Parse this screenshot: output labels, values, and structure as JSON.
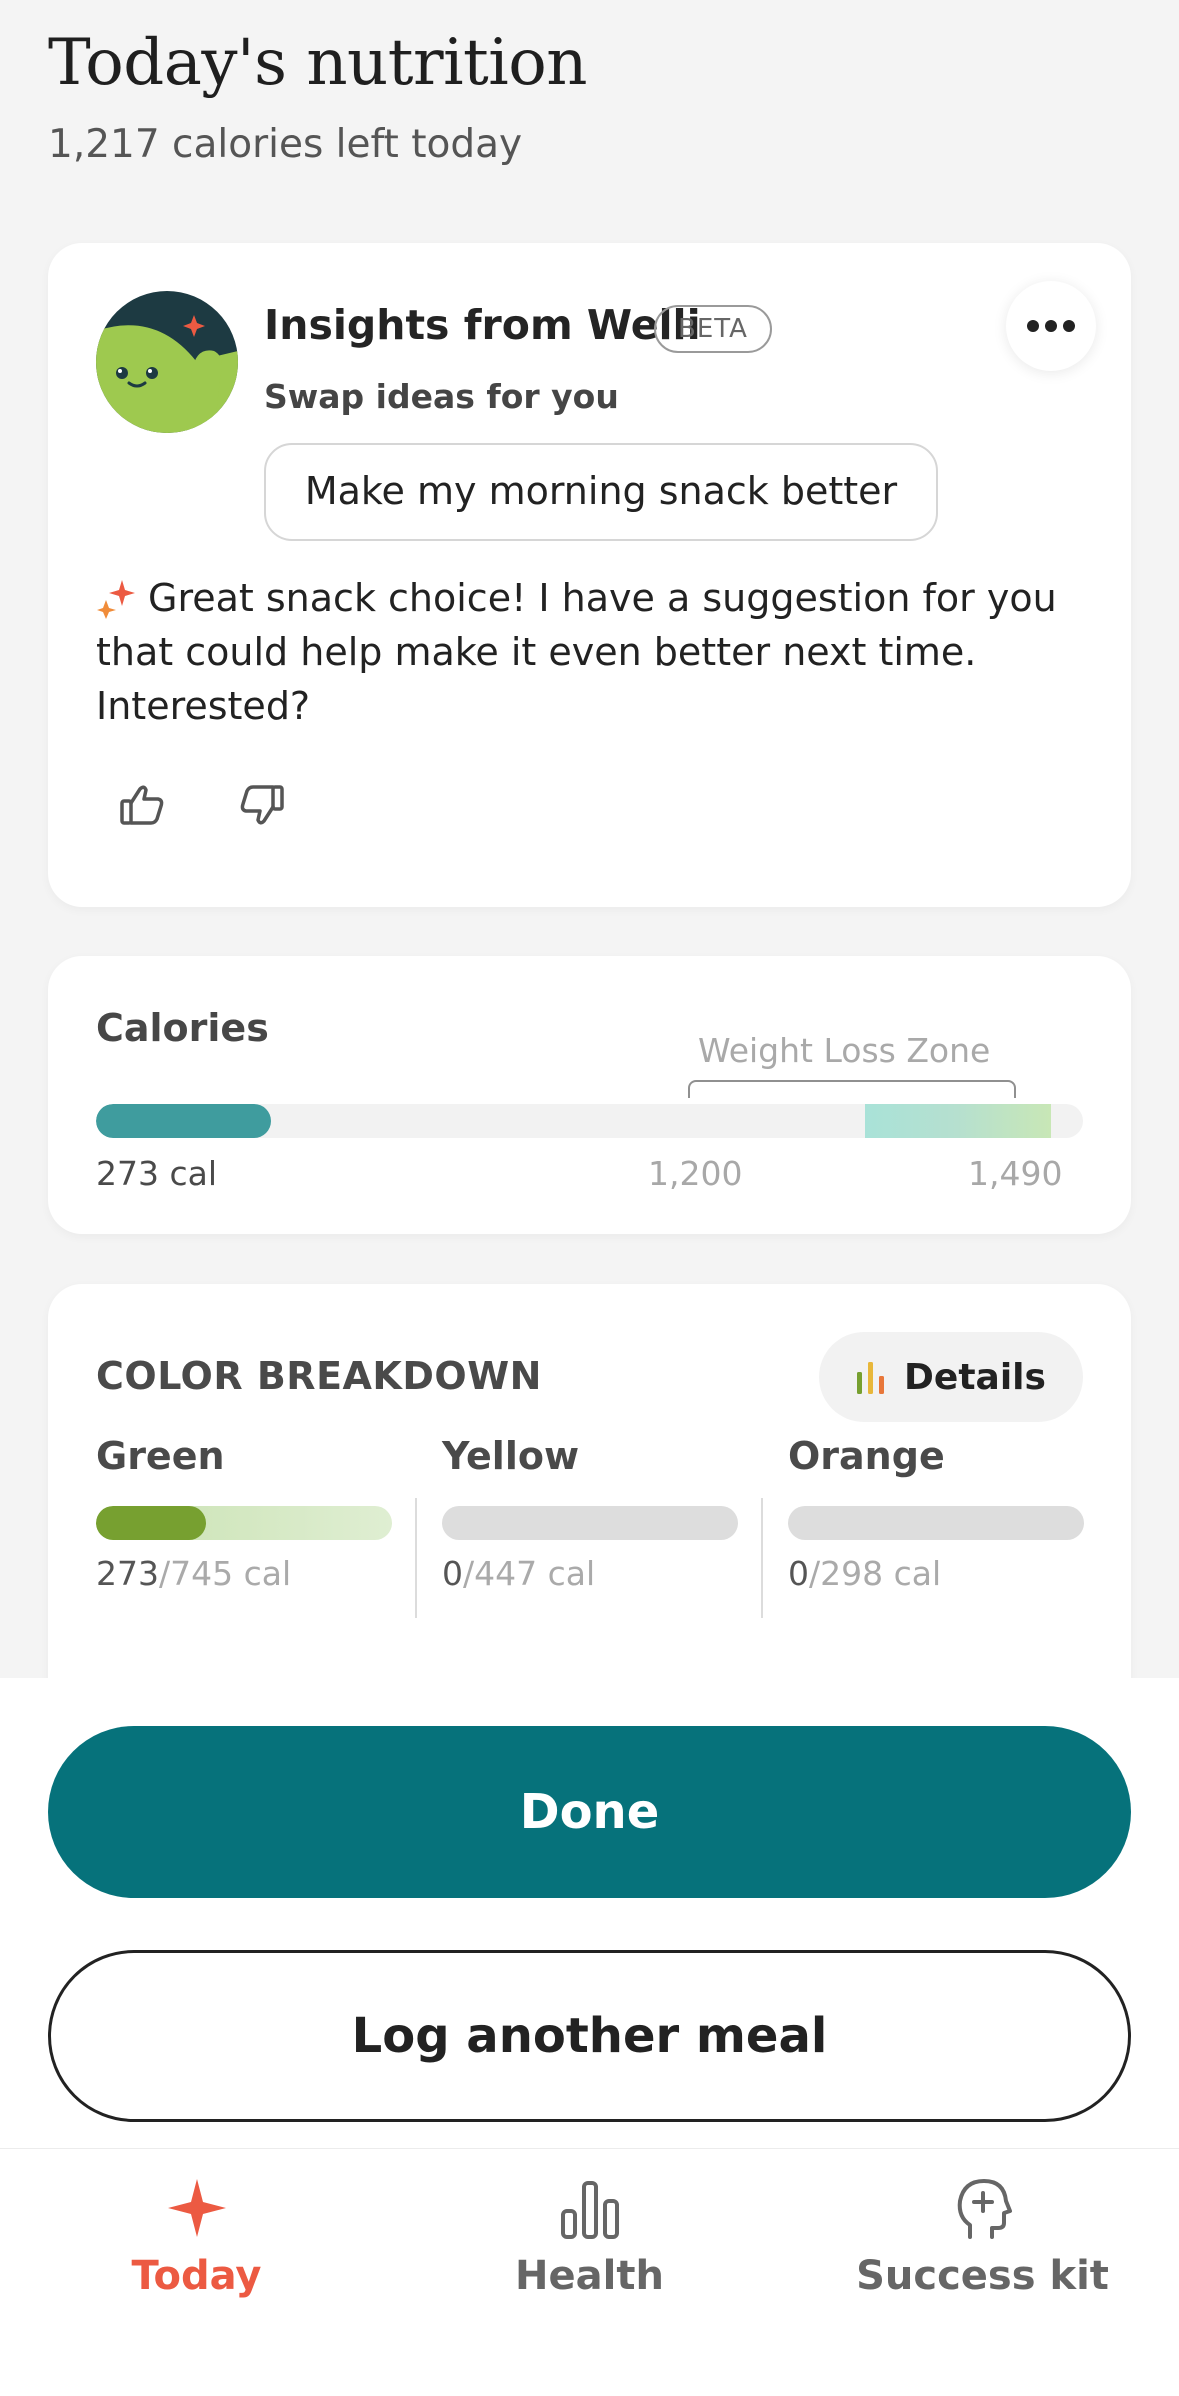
{
  "header": {
    "title": "Today's nutrition",
    "subtitle": "1,217 calories left today"
  },
  "insights": {
    "title": "Insights from Welli",
    "badge": "BETA",
    "subtitle": "Swap ideas for you",
    "prompt_chip": "Make my morning snack better",
    "message": "Great snack choice! I have a suggestion for you that could help make it even better next time. Interested?",
    "avatar_icon": "welli-mascot-icon",
    "more_icon": "more-dots-icon"
  },
  "calories": {
    "title": "Calories",
    "zone_label": "Weight Loss Zone",
    "current_label": "273 cal",
    "current": 273,
    "zone_min_label": "1,200",
    "zone_max_label": "1,490",
    "zone_min": 1200,
    "zone_max": 1490,
    "scale_max": 1540,
    "accent": "#3f9c9e"
  },
  "breakdown": {
    "title": "COLOR BREAKDOWN",
    "details_label": "Details",
    "columns": [
      {
        "name": "Green",
        "current": "273",
        "total": "/745 cal",
        "fraction": 0.37,
        "color": "#77a030"
      },
      {
        "name": "Yellow",
        "current": "0",
        "total": "/447 cal",
        "fraction": 0,
        "color": "#e8b73a"
      },
      {
        "name": "Orange",
        "current": "0",
        "total": "/298 cal",
        "fraction": 0,
        "color": "#e8773a"
      }
    ]
  },
  "actions": {
    "done_label": "Done",
    "log_label": "Log another meal",
    "primary_color": "#06727b"
  },
  "tabs": [
    {
      "label": "Today",
      "icon": "sparkle-icon",
      "active": true
    },
    {
      "label": "Health",
      "icon": "bar-chart-icon",
      "active": false
    },
    {
      "label": "Success kit",
      "icon": "head-plus-icon",
      "active": false
    }
  ]
}
